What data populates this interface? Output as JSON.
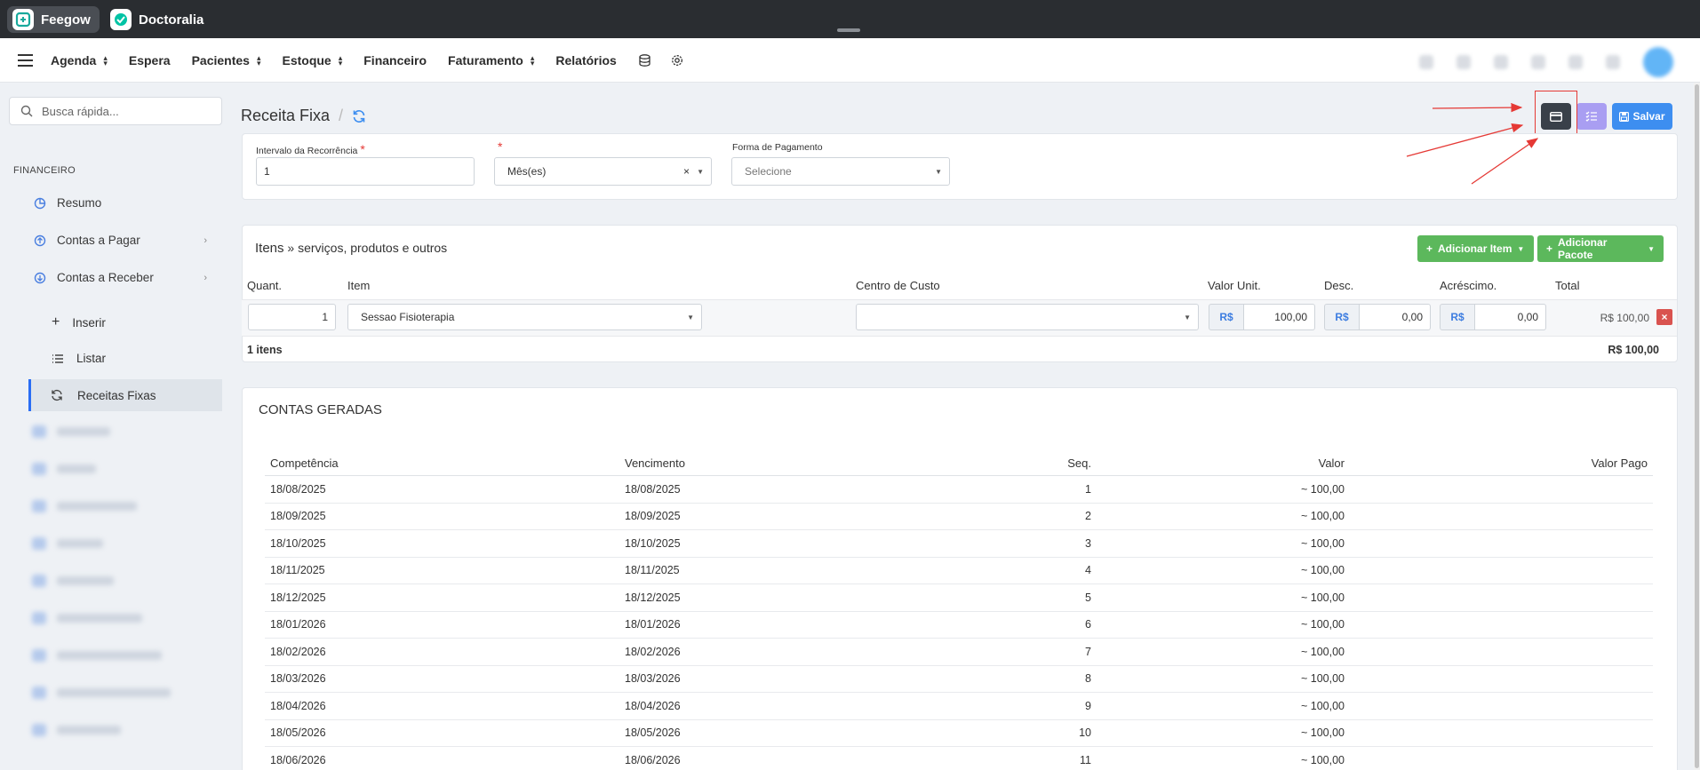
{
  "browser": {
    "tabs": [
      {
        "label": "Feegow",
        "active": true
      },
      {
        "label": "Doctoralia",
        "active": false
      }
    ]
  },
  "nav": {
    "items": [
      "Agenda",
      "Espera",
      "Pacientes",
      "Estoque",
      "Financeiro",
      "Faturamento",
      "Relatórios"
    ]
  },
  "sidebar": {
    "search_placeholder": "Busca rápida...",
    "section_title": "FINANCEIRO",
    "items": {
      "resumo": "Resumo",
      "contas_pagar": "Contas a Pagar",
      "contas_receber": "Contas a Receber",
      "inserir": "Inserir",
      "listar": "Listar",
      "receitas_fixas": "Receitas Fixas"
    }
  },
  "header": {
    "title": "Receita Fixa",
    "save_label": "Salvar"
  },
  "form": {
    "intervalo_label": "Intervalo da Recorrência",
    "intervalo_value": "1",
    "periodo_value": "Mês(es)",
    "forma_label": "Forma de Pagamento",
    "forma_placeholder": "Selecione"
  },
  "items": {
    "title_strong": "Itens",
    "title_rest": " » serviços, produtos e outros",
    "add_item_label": "Adicionar Item",
    "add_pacote_label": "Adicionar Pacote",
    "columns": [
      "Quant.",
      "Item",
      "Centro de Custo",
      "Valor Unit.",
      "Desc.",
      "Acréscimo.",
      "Total"
    ],
    "row": {
      "quant": "1",
      "item": "Sessao Fisioterapia",
      "centro": "",
      "currency": "R$",
      "valor": "100,00",
      "desc": "0,00",
      "acrescimo": "0,00",
      "total": "R$ 100,00"
    },
    "footer_count": "1 itens",
    "footer_total": "R$ 100,00"
  },
  "contas": {
    "title": "CONTAS GERADAS",
    "columns": [
      "Competência",
      "Vencimento",
      "Seq.",
      "Valor",
      "Valor Pago"
    ],
    "rows": [
      [
        "18/08/2025",
        "18/08/2025",
        "1",
        "~ 100,00",
        ""
      ],
      [
        "18/09/2025",
        "18/09/2025",
        "2",
        "~ 100,00",
        ""
      ],
      [
        "18/10/2025",
        "18/10/2025",
        "3",
        "~ 100,00",
        ""
      ],
      [
        "18/11/2025",
        "18/11/2025",
        "4",
        "~ 100,00",
        ""
      ],
      [
        "18/12/2025",
        "18/12/2025",
        "5",
        "~ 100,00",
        ""
      ],
      [
        "18/01/2026",
        "18/01/2026",
        "6",
        "~ 100,00",
        ""
      ],
      [
        "18/02/2026",
        "18/02/2026",
        "7",
        "~ 100,00",
        ""
      ],
      [
        "18/03/2026",
        "18/03/2026",
        "8",
        "~ 100,00",
        ""
      ],
      [
        "18/04/2026",
        "18/04/2026",
        "9",
        "~ 100,00",
        ""
      ],
      [
        "18/05/2026",
        "18/05/2026",
        "10",
        "~ 100,00",
        ""
      ],
      [
        "18/06/2026",
        "18/06/2026",
        "11",
        "~ 100,00",
        ""
      ]
    ]
  },
  "colors": {
    "accent_blue": "#3d8ef0",
    "success_green": "#5cb85c",
    "danger_red": "#d9534f",
    "annotation_red": "#e53935"
  }
}
